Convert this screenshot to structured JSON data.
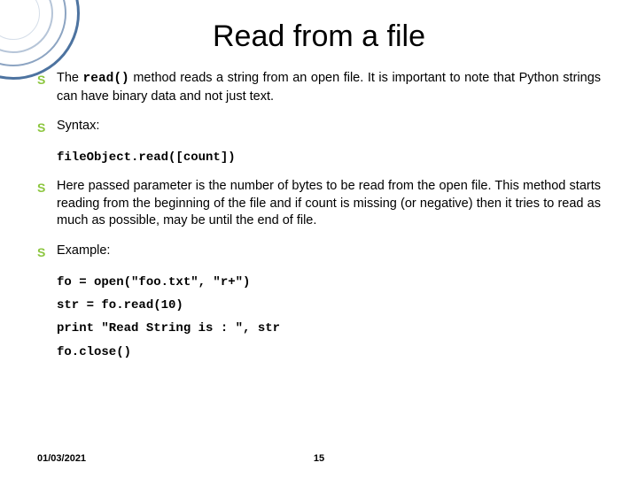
{
  "title": "Read from a file",
  "bullets": {
    "b1_pre": "The ",
    "b1_code": "read()",
    "b1_post": " method reads a string from an open file. It is important to note that Python strings can have binary data and not just text.",
    "b2": "Syntax:",
    "syntax_code": "fileObject.read([count])",
    "b3": "Here passed parameter is the number of bytes to be read from the open file. This method starts reading from the beginning of the file and if count is missing (or negative) then it tries to read as much as possible, may be until the end of file.",
    "b4": "Example:",
    "ex1": "fo = open(\"foo.txt\", \"r+\")",
    "ex2": "str = fo.read(10)",
    "ex3": "print \"Read String is : \", str",
    "ex4": "fo.close()"
  },
  "footer": {
    "date": "01/03/2021",
    "page": "15"
  },
  "bullet_char": "S"
}
